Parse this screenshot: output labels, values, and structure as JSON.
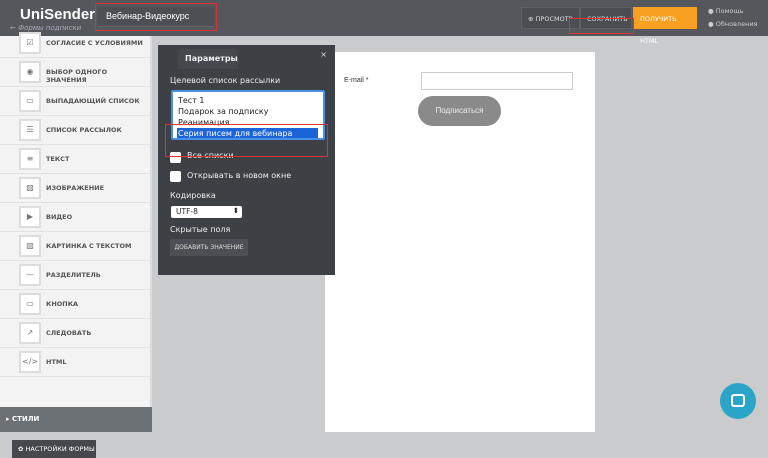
{
  "header": {
    "logo": "UniSender",
    "logo_sub": "← Формы подписки",
    "form_title": "Вебинар-Видеокурс",
    "preview": "ПРОСМОТР",
    "save": "СОХРАНИТЬ",
    "get_html": "ПОЛУЧИТЬ HTML",
    "help": "Помощь",
    "updates": "Обновления"
  },
  "sidebar": {
    "items": [
      {
        "label": "СОГЛАСИЕ С УСЛОВИЯМИ",
        "icon": "☑"
      },
      {
        "label": "ВЫБОР ОДНОГО ЗНАЧЕНИЯ",
        "icon": "◉"
      },
      {
        "label": "ВЫПАДАЮЩИЙ СПИСОК",
        "icon": "▭"
      },
      {
        "label": "СПИСОК РАССЫЛОК",
        "icon": "☰"
      },
      {
        "label": "ТЕКСТ",
        "icon": "≡"
      },
      {
        "label": "ИЗОБРАЖЕНИЕ",
        "icon": "▨"
      },
      {
        "label": "ВИДЕО",
        "icon": "▶"
      },
      {
        "label": "КАРТИНКА С ТЕКСТОМ",
        "icon": "▨"
      },
      {
        "label": "РАЗДЕЛИТЕЛЬ",
        "icon": "—"
      },
      {
        "label": "КНОПКА",
        "icon": "▭"
      },
      {
        "label": "СЛЕДОВАТЬ",
        "icon": "↗"
      },
      {
        "label": "HTML",
        "icon": "</>"
      }
    ],
    "styles": "СТИЛИ",
    "form_settings": "НАСТРОЙКИ ФОРМЫ"
  },
  "panel": {
    "tab": "Параметры",
    "close": "×",
    "target_list_label": "Целевой список рассылки",
    "lists": [
      "Тест 1",
      "Подарок за подписку",
      "Реанимация",
      "Серия писем для вебинара"
    ],
    "selected_list": "Серия писем для вебинара",
    "all_lists": "Все списки",
    "new_window": "Открывать в новом окне",
    "encoding_label": "Кодировка",
    "encoding": "UTF-8",
    "hidden_fields": "Скрытые поля",
    "add_value": "ДОБАВИТЬ ЗНАЧЕНИЕ"
  },
  "form": {
    "email_label": "E-mail *",
    "submit": "Подписаться"
  }
}
